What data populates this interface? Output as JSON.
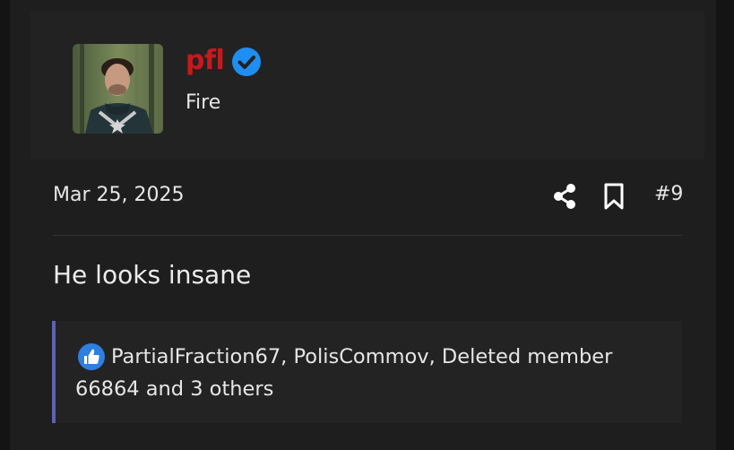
{
  "post": {
    "user": {
      "name": "pfl",
      "title": "Fire",
      "verified": true,
      "name_color": "#c8191d"
    },
    "date": "Mar 25, 2025",
    "post_number": "#9",
    "message": "He looks insane",
    "reactions": {
      "text": "PartialFraction67, PolisCommov, Deleted member 66864 and 3 others",
      "icon": "thumbs-up-icon",
      "accent_color": "#5d63b0"
    }
  },
  "colors": {
    "background": "#141414",
    "post_bg": "#1e1e1e",
    "user_bar_bg": "#222222",
    "verified_blue": "#1d8ff2",
    "like_blue": "#2f7fe0"
  }
}
